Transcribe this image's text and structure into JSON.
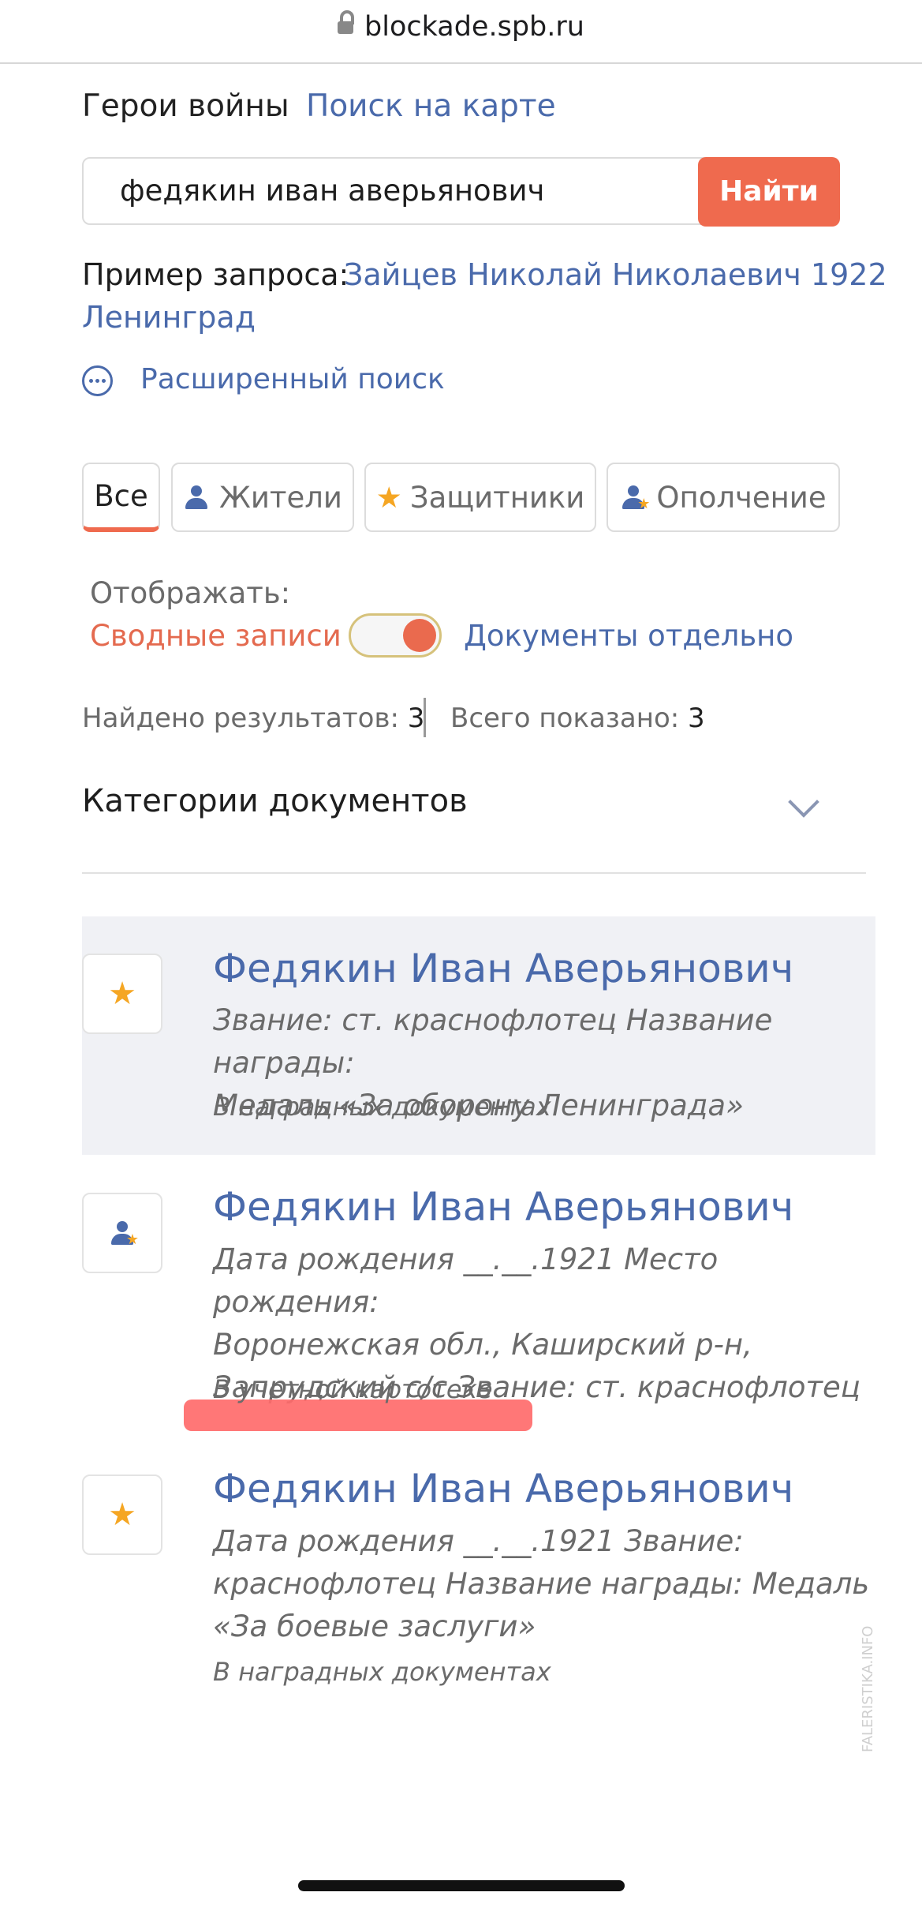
{
  "browser": {
    "url": "blockade.spb.ru"
  },
  "nav": {
    "heroes": "Герои войны",
    "map_search": "Поиск на карте"
  },
  "search": {
    "value": "федякин иван аверьянович",
    "button": "Найти"
  },
  "example": {
    "label": "Пример запроса:",
    "link_line1": "Зайцев Николай Николаевич 1922",
    "link_line2": "Ленинград"
  },
  "advanced": {
    "label": "Расширенный поиск"
  },
  "tabs": [
    {
      "label": "Все",
      "active": true
    },
    {
      "label": "Жители"
    },
    {
      "label": "Защитники"
    },
    {
      "label": "Ополчение"
    }
  ],
  "display": {
    "label": "Отображать:",
    "option_left": "Сводные записи",
    "option_right": "Документы отдельно",
    "toggle_on": true
  },
  "stats": {
    "found_label": "Найдено результатов:",
    "found_value": "3",
    "shown_label": "Всего показано:",
    "shown_value": "3"
  },
  "categories": {
    "title": "Категории документов"
  },
  "results": [
    {
      "icon": "star-icon",
      "name": "Федякин Иван Аверьянович",
      "desc_lines": [
        "Звание: ст. краснофлотец Название награды:",
        "Медаль «За оборону Ленинграда»"
      ],
      "source": "В наградных документах"
    },
    {
      "icon": "person-star-icon",
      "name": "Федякин Иван Аверьянович",
      "desc_lines": [
        "Дата рождения __.__.1921 Место рождения:",
        "Воронежская обл., Каширский р-н,",
        "Запрудский с/с Звание: ст. краснофлотец"
      ],
      "source": "В учетной картотеке"
    },
    {
      "icon": "star-icon",
      "name": "Федякин Иван Аверьянович",
      "desc_lines": [
        "Дата рождения __.__.1921 Звание:",
        "краснофлотец Название награды: Медаль",
        "«За боевые заслуги»"
      ],
      "source": "В наградных документах"
    }
  ],
  "watermark": "FALERISTIKA.INFO",
  "colors": {
    "accent": "#ef6a4e",
    "link": "#4a6aab",
    "star": "#f5a623",
    "highlight": "#ff6b6b"
  }
}
